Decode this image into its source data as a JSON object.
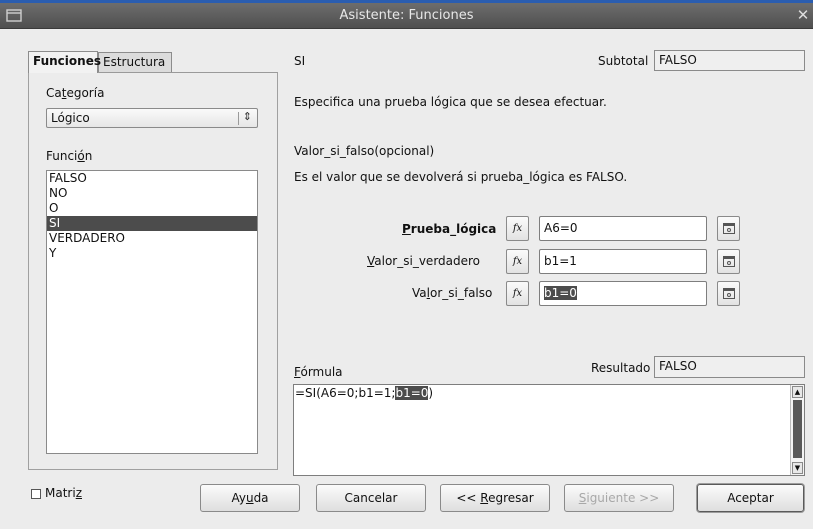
{
  "window": {
    "title": "Asistente: Funciones",
    "close_glyph": "✕"
  },
  "tabs": [
    {
      "label": "Funciones",
      "active": true
    },
    {
      "label": "Estructura",
      "active": false
    }
  ],
  "left": {
    "category_label_pre": "Ca",
    "category_label_u": "t",
    "category_label_post": "egoría",
    "category_value": "Lógico",
    "function_label_pre": "Funci",
    "function_label_u": "ó",
    "function_label_post": "n",
    "functions": [
      "FALSO",
      "NO",
      "O",
      "SI",
      "VERDADERO",
      "Y"
    ],
    "selected_function": "SI"
  },
  "right": {
    "function_name": "SI",
    "subtotal_label": "Subtotal",
    "subtotal_value": "FALSO",
    "description": "Especifica una prueba lógica que se desea efectuar.",
    "arg_title": "Valor_si_falso(opcional)",
    "arg_description": "Es el valor que se devolverá si prueba_lógica es FALSO.",
    "args": [
      {
        "label_u": "P",
        "label_rest": "rueba_lógica",
        "value": "A6=0"
      },
      {
        "label_u": "V",
        "label_rest": "alor_si_verdadero",
        "value": "b1=1"
      },
      {
        "label_pre": "Va",
        "label_u": "l",
        "label_rest": "or_si_falso",
        "value": "b1=0"
      }
    ],
    "fx_symbol": "fx",
    "formula_label_u": "F",
    "formula_label_rest": "órmula",
    "result_label": "Resultado",
    "result_value": "FALSO",
    "formula_text_pre": "=SI(A6=0;b1=1;",
    "formula_text_hl": "b1=0",
    "formula_text_post": ")"
  },
  "bottom": {
    "matrix_label_pre": "Matri",
    "matrix_label_u": "z",
    "help_pre": "Ay",
    "help_u": "u",
    "help_post": "da",
    "cancel": "Cancelar",
    "back_pre": "<< ",
    "back_u": "R",
    "back_post": "egresar",
    "next_u": "S",
    "next_post": "iguiente >>",
    "accept": "Aceptar"
  }
}
